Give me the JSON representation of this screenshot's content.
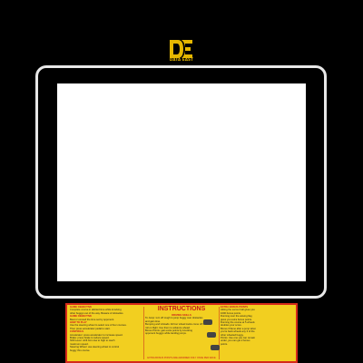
{
  "brand": {
    "logo_text": "DATA EAST"
  },
  "instructions": {
    "title": "INSTRUCTIONS",
    "left": [
      {
        "heading": "GAME OBJECTIVE",
        "lines": [
          "Complete course in allotted time while knocking",
          "other buggys out of the way. Beware of obstacles."
        ]
      },
      {
        "heading": "GAME OBJECTIVE",
        "lines": [
          "Beat or exceed the time set by opponent."
        ]
      },
      {
        "heading": "HOW TO PLAY",
        "lines": [
          "Use the steering wheel to select one of four courses.",
          "Then press accelerator pedal to start."
        ]
      },
      {
        "heading": "CONTROLS",
        "lines": [
          "Accelerator: press accelerator to increase speed.",
          "Brake: press brake to reduce speed.",
          "Shift Lever: shift from low to high to reach",
          "maximum speed.",
          "Steering Wheel: use steering wheel to control",
          "buggy thru course."
        ]
      }
    ],
    "center": [
      {
        "heading": "DRIVING SKILLS",
        "lines": [
          "To Jump: turn off rough to jump buggy over obstacles",
          "and gain time.",
          "Bumping and Unloads: All four wheel tracks come off the",
          "roll on flight. Use them to advance ahead.",
          "Bonus Points: gain extra points by knocking",
          "opponent buggys while landing jumps."
        ]
      }
    ],
    "right": [
      {
        "heading": "EXTRA BONUS POINTS",
        "lines": [
          "Hitting the soccer ball gives you",
          "1000 bonus points.",
          "Running over the waving flag",
          "gives you extra bonus points.",
          "Running the course at 5 wheels",
          "doubles your score.",
          "Bonus if flame after a jump when",
          "you're back wheels any 3 of the",
          "other wheeled buggy.",
          "Points: Use one you can remain",
          "under, you can get 2 bonus",
          "points."
        ]
      }
    ],
    "footer": "EXTRA BONUS POINTS ARE AWARDED ONLY ONCE PER RACE"
  }
}
